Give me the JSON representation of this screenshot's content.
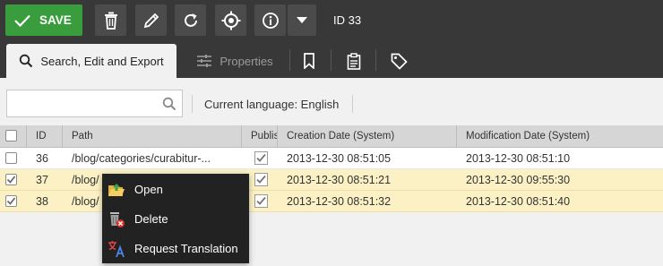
{
  "toolbar": {
    "save_label": "SAVE",
    "id_label": "ID 33",
    "buttons": [
      "trash-icon",
      "pencil-icon",
      "reload-icon",
      "target-icon",
      "info-icon",
      "caret-down-icon"
    ]
  },
  "tabs": [
    {
      "label": "Search, Edit and Export",
      "icon": "search-icon",
      "active": true
    },
    {
      "label": "Properties",
      "icon": "sliders-icon",
      "active": false
    },
    {
      "label": "",
      "icon": "bookmark-icon",
      "active": false
    },
    {
      "label": "",
      "icon": "clipboard-icon",
      "active": false
    },
    {
      "label": "",
      "icon": "tag-icon",
      "active": false
    }
  ],
  "filter": {
    "search_value": "",
    "current_language": "Current language: English"
  },
  "grid": {
    "columns": [
      "",
      "ID",
      "Path",
      "Publis",
      "Creation Date (System)",
      "Modification Date (System)"
    ],
    "rows": [
      {
        "id": "36",
        "path": "/blog/categories/curabitur-...",
        "published": true,
        "created": "2013-12-30 08:51:05",
        "modified": "2013-12-30 08:51:10",
        "selected": false
      },
      {
        "id": "37",
        "path": "/blog/",
        "published": true,
        "created": "2013-12-30 08:51:21",
        "modified": "2013-12-30 09:55:30",
        "selected": true
      },
      {
        "id": "38",
        "path": "/blog/",
        "published": true,
        "created": "2013-12-30 08:51:32",
        "modified": "2013-12-30 08:51:40",
        "selected": true
      }
    ]
  },
  "context_menu": {
    "items": [
      {
        "label": "Open",
        "icon": "folder-open-icon"
      },
      {
        "label": "Delete",
        "icon": "delete-icon"
      },
      {
        "label": "Request Translation",
        "icon": "translate-icon"
      }
    ]
  },
  "colors": {
    "toolbar_bg": "#383838",
    "save_green": "#3a9d3d",
    "row_selected": "#fbf1c4",
    "menu_bg": "#222222"
  }
}
